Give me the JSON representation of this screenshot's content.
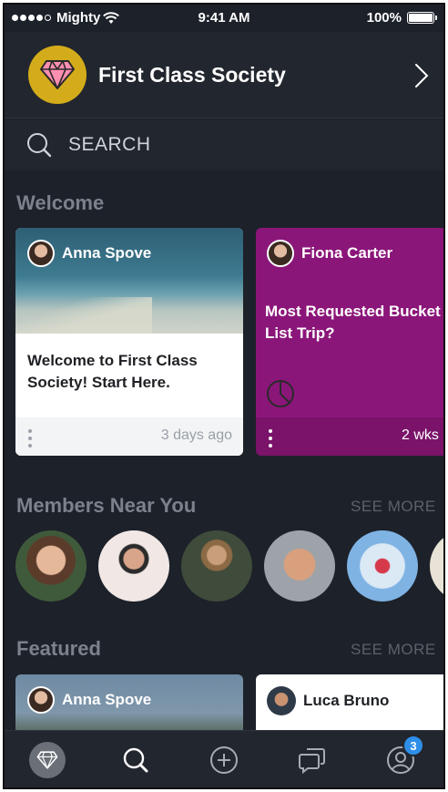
{
  "status_bar": {
    "carrier": "Mighty",
    "time": "9:41 AM",
    "battery": "100%"
  },
  "header": {
    "community_name": "First Class Society",
    "logo_icon": "diamond-icon",
    "logo_color": "#d4ac1b"
  },
  "search": {
    "label": "SEARCH"
  },
  "welcome": {
    "title": "Welcome",
    "cards": [
      {
        "author": "Anna Spove",
        "text": "Welcome to First Class Society! Start Here.",
        "time": "3 days ago"
      },
      {
        "author": "Fiona Carter",
        "text": "Most Requested Bucket List Trip?",
        "time": "2 wks",
        "color": "#8b1679"
      }
    ]
  },
  "members": {
    "title": "Members Near You",
    "see_more": "SEE MORE"
  },
  "featured": {
    "title": "Featured",
    "see_more": "SEE MORE",
    "cards": [
      {
        "author": "Anna Spove"
      },
      {
        "author": "Luca Bruno"
      }
    ]
  },
  "tabbar": {
    "notification_count": "3",
    "accent": "#2e8fe8"
  }
}
